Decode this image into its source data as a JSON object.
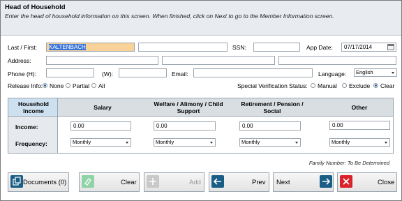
{
  "header": {
    "title": "Head of Household",
    "subtitle": "Enter the head of household information on this screen.  When finished, click on Next to go to the Member Information screen."
  },
  "form": {
    "last_first_label": "Last / First:",
    "last_name_value": "KALTENBACH",
    "first_name_value": "",
    "ssn_label": "SSN:",
    "ssn_value": "",
    "app_date_label": "App Date:",
    "app_date_value": "07/17/2014",
    "address_label": "Address:",
    "address1_value": "",
    "address2_value": "",
    "address3_value": "",
    "phone_h_label": "Phone (H):",
    "phone_h_value": "",
    "phone_w_label": "(W):",
    "phone_w_value": "",
    "email_label": "Email:",
    "email_value": "",
    "language_label": "Language:",
    "language_value": "English",
    "release_info_label": "Release Info:",
    "release_options": [
      "None",
      "Partial",
      "All"
    ],
    "release_selected": "None",
    "special_verification_label": "Special Verification Status:",
    "verification_options": [
      "Manual",
      "Exclude",
      "Clear"
    ],
    "verification_selected": "Clear"
  },
  "income_table": {
    "corner_header": "Household Income",
    "columns": [
      "Salary",
      "Welfare / Alimony / Child Support",
      "Retirement / Pension / Social",
      "Other"
    ],
    "income_label": "Income:",
    "frequency_label": "Frequency:",
    "income_values": [
      "0.00",
      "0.00",
      "0.00",
      "0.00"
    ],
    "frequency_values": [
      "Monthly",
      "Monthly",
      "Monthly",
      "Monthly"
    ]
  },
  "family_number_text": "Family Number: To Be Determined",
  "buttons": {
    "documents": "Documents (0)",
    "clear": "Clear",
    "add": "Add",
    "prev": "Prev",
    "next": "Next",
    "close": "Close"
  },
  "colors": {
    "header_bg": "#e8ecf0",
    "table_header_bg": "#d9dee3",
    "accent_blue": "#1f5fa8",
    "nav_teal": "#1a5e86",
    "close_red": "#d9222a",
    "clear_green": "#8fd3a6"
  }
}
